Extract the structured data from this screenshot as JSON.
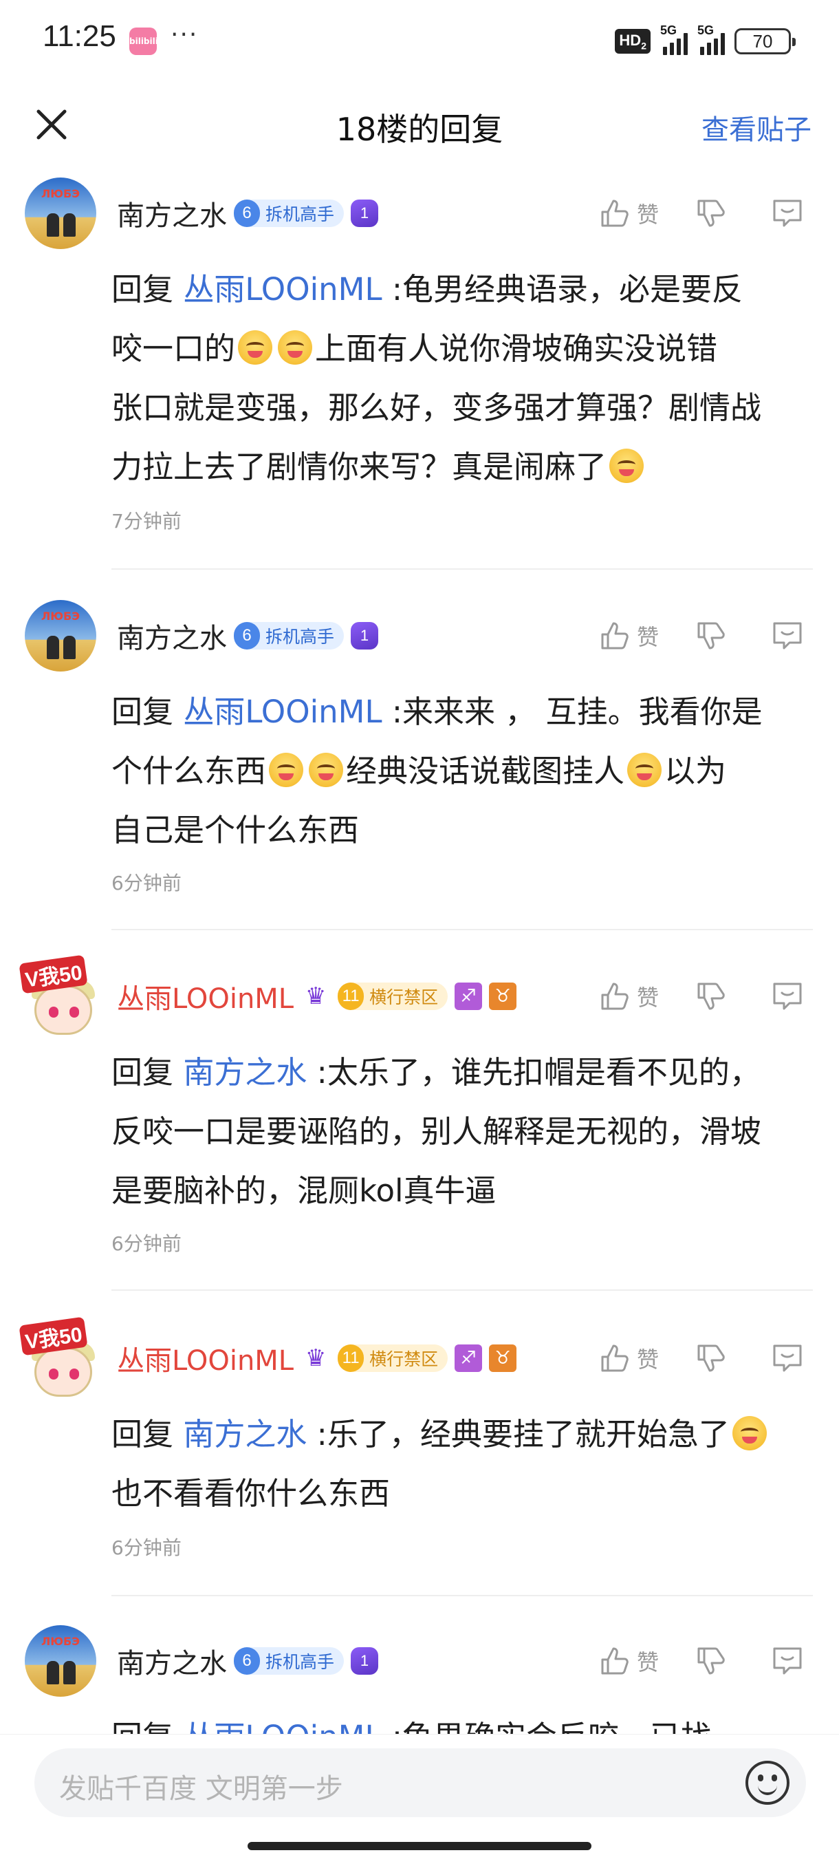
{
  "status_bar": {
    "time": "11:25",
    "app_badge": "bilibili",
    "more": "···",
    "hd": "HD",
    "hd_sub": "2",
    "signal1": "5G",
    "signal2": "5G",
    "battery": "70"
  },
  "nav": {
    "title": "18楼的回复",
    "view_post": "查看贴子"
  },
  "actions": {
    "like_label": "赞"
  },
  "comments": [
    {
      "username": "南方之水",
      "level": "6",
      "title": "拆机高手",
      "medal": "1",
      "reply_prefix": "回复",
      "mention": "丛雨LOOinML",
      "text_lines": [
        ":龟男经典语录，必是要反",
        "咬一口的",
        "上面有人说你滑坡确实没说错",
        "张口就是变强，那么好，变多强才算强？剧情战",
        "力拉上去了剧情你来写？真是闹麻了"
      ],
      "time": "7分钟前"
    },
    {
      "username": "南方之水",
      "level": "6",
      "title": "拆机高手",
      "medal": "1",
      "reply_prefix": "回复",
      "mention": "丛雨LOOinML",
      "text_lines": [
        ":来来来 ， 互挂。我看你是",
        "个什么东西",
        "经典没话说截图挂人",
        "以为",
        "自己是个什么东西"
      ],
      "time": "6分钟前"
    },
    {
      "username": "丛雨LOOinML",
      "level": "11",
      "title": "横行禁区",
      "avatar_tag": "V我50",
      "zodiac1": "♐",
      "zodiac2": "♉",
      "reply_prefix": "回复",
      "mention": "南方之水",
      "text_lines": [
        ":太乐了，谁先扣帽是看不见的，",
        "反咬一口是要诬陷的，别人解释是无视的，滑坡",
        "是要脑补的，混厕kol真牛逼"
      ],
      "time": "6分钟前"
    },
    {
      "username": "丛雨LOOinML",
      "level": "11",
      "title": "横行禁区",
      "avatar_tag": "V我50",
      "zodiac1": "♐",
      "zodiac2": "♉",
      "reply_prefix": "回复",
      "mention": "南方之水",
      "text_lines": [
        ":乐了，经典要挂了就开始急了",
        "也不看看你什么东西"
      ],
      "time": "6分钟前"
    },
    {
      "username": "南方之水",
      "level": "6",
      "title": "拆机高手",
      "medal": "1",
      "reply_prefix": "回复",
      "mention": "丛雨LOOinML",
      "text_lines": [
        ":龟男确实会反咬，已找..."
      ]
    }
  ],
  "input": {
    "placeholder": "发贴千百度 文明第一步"
  }
}
